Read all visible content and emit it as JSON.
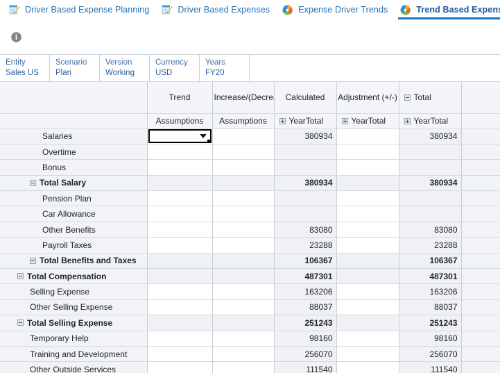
{
  "tabs": [
    {
      "label": "Driver Based Expense Planning",
      "icon": "form-pencil-icon",
      "active": false
    },
    {
      "label": "Driver Based Expenses",
      "icon": "form-pencil-icon",
      "active": false
    },
    {
      "label": "Expense Driver Trends",
      "icon": "dashboard-pie-icon",
      "active": false
    },
    {
      "label": "Trend Based Expense Planning",
      "icon": "dashboard-pie-icon",
      "active": true
    }
  ],
  "toolbar": {
    "info_icon": "info-icon"
  },
  "pov": [
    {
      "dimension": "Entity",
      "member": "Sales US"
    },
    {
      "dimension": "Scenario",
      "member": "Plan"
    },
    {
      "dimension": "Version",
      "member": "Working"
    },
    {
      "dimension": "Currency",
      "member": "USD"
    },
    {
      "dimension": "Years",
      "member": "FY20"
    }
  ],
  "grid": {
    "column_groups": [
      {
        "label": "Trend",
        "icon": null
      },
      {
        "label": "% Increase/(Decreas",
        "icon": null
      },
      {
        "label": "Calculated",
        "icon": null
      },
      {
        "label": "Adjustment (+/-)",
        "icon": null
      },
      {
        "label": "Total",
        "icon": "minus-box-icon"
      }
    ],
    "column_members": [
      {
        "label": "Assumptions",
        "icon": null
      },
      {
        "label": "Assumptions",
        "icon": null
      },
      {
        "label": "YearTotal",
        "icon": "plus-box-icon"
      },
      {
        "label": "YearTotal",
        "icon": "plus-box-icon"
      },
      {
        "label": "YearTotal",
        "icon": "plus-box-icon"
      }
    ],
    "selected_cell": {
      "row": "Salaries",
      "column": "Trend",
      "value": "",
      "type": "dropdown"
    },
    "rows": [
      {
        "label": "Salaries",
        "indent": 2,
        "bold": false,
        "icon": null,
        "trend": "",
        "pct": "",
        "calculated": "380934",
        "adjustment": "",
        "total": "380934",
        "editable": true,
        "selected": true
      },
      {
        "label": "Overtime",
        "indent": 2,
        "bold": false,
        "icon": null,
        "trend": "",
        "pct": "",
        "calculated": "",
        "adjustment": "",
        "total": "",
        "editable": true,
        "selected": false
      },
      {
        "label": "Bonus",
        "indent": 2,
        "bold": false,
        "icon": null,
        "trend": "",
        "pct": "",
        "calculated": "",
        "adjustment": "",
        "total": "",
        "editable": true,
        "selected": false
      },
      {
        "label": "Total Salary",
        "indent": 1,
        "bold": true,
        "icon": "minus-box-icon",
        "trend": "",
        "pct": "",
        "calculated": "380934",
        "adjustment": "",
        "total": "380934",
        "editable": false,
        "selected": false
      },
      {
        "label": "Pension Plan",
        "indent": 2,
        "bold": false,
        "icon": null,
        "trend": "",
        "pct": "",
        "calculated": "",
        "adjustment": "",
        "total": "",
        "editable": true,
        "selected": false
      },
      {
        "label": "Car Allowance",
        "indent": 2,
        "bold": false,
        "icon": null,
        "trend": "",
        "pct": "",
        "calculated": "",
        "adjustment": "",
        "total": "",
        "editable": true,
        "selected": false
      },
      {
        "label": "Other Benefits",
        "indent": 2,
        "bold": false,
        "icon": null,
        "trend": "",
        "pct": "",
        "calculated": "83080",
        "adjustment": "",
        "total": "83080",
        "editable": true,
        "selected": false
      },
      {
        "label": "Payroll Taxes",
        "indent": 2,
        "bold": false,
        "icon": null,
        "trend": "",
        "pct": "",
        "calculated": "23288",
        "adjustment": "",
        "total": "23288",
        "editable": true,
        "selected": false
      },
      {
        "label": "Total Benefits and Taxes",
        "indent": 1,
        "bold": true,
        "icon": "minus-box-icon",
        "trend": "",
        "pct": "",
        "calculated": "106367",
        "adjustment": "",
        "total": "106367",
        "editable": false,
        "selected": false
      },
      {
        "label": "Total Compensation",
        "indent": 0,
        "bold": true,
        "icon": "minus-box-icon",
        "trend": "",
        "pct": "",
        "calculated": "487301",
        "adjustment": "",
        "total": "487301",
        "editable": false,
        "selected": false
      },
      {
        "label": "Selling Expense",
        "indent": 1,
        "bold": false,
        "icon": null,
        "trend": "",
        "pct": "",
        "calculated": "163206",
        "adjustment": "",
        "total": "163206",
        "editable": true,
        "selected": false
      },
      {
        "label": "Other Selling Expense",
        "indent": 1,
        "bold": false,
        "icon": null,
        "trend": "",
        "pct": "",
        "calculated": "88037",
        "adjustment": "",
        "total": "88037",
        "editable": true,
        "selected": false
      },
      {
        "label": "Total Selling Expense",
        "indent": 0,
        "bold": true,
        "icon": "minus-box-icon",
        "trend": "",
        "pct": "",
        "calculated": "251243",
        "adjustment": "",
        "total": "251243",
        "editable": false,
        "selected": false
      },
      {
        "label": "Temporary Help",
        "indent": 1,
        "bold": false,
        "icon": null,
        "trend": "",
        "pct": "",
        "calculated": "98160",
        "adjustment": "",
        "total": "98160",
        "editable": true,
        "selected": false
      },
      {
        "label": "Training and Development",
        "indent": 1,
        "bold": false,
        "icon": null,
        "trend": "",
        "pct": "",
        "calculated": "256070",
        "adjustment": "",
        "total": "256070",
        "editable": true,
        "selected": false
      },
      {
        "label": "Other Outside Services",
        "indent": 1,
        "bold": false,
        "icon": null,
        "trend": "",
        "pct": "",
        "calculated": "111540",
        "adjustment": "",
        "total": "111540",
        "editable": true,
        "selected": false
      }
    ]
  },
  "colors": {
    "tab_link": "#2171b5",
    "tab_active": "#1a5a9e",
    "tab_underline": "#1878bd",
    "pov_text": "#2a5f9e",
    "readonly_cell": "#eff1f5",
    "header_cell": "#f3f5f8",
    "row_header_cell": "#f1f3f7",
    "grid_line": "#c9ced6"
  }
}
